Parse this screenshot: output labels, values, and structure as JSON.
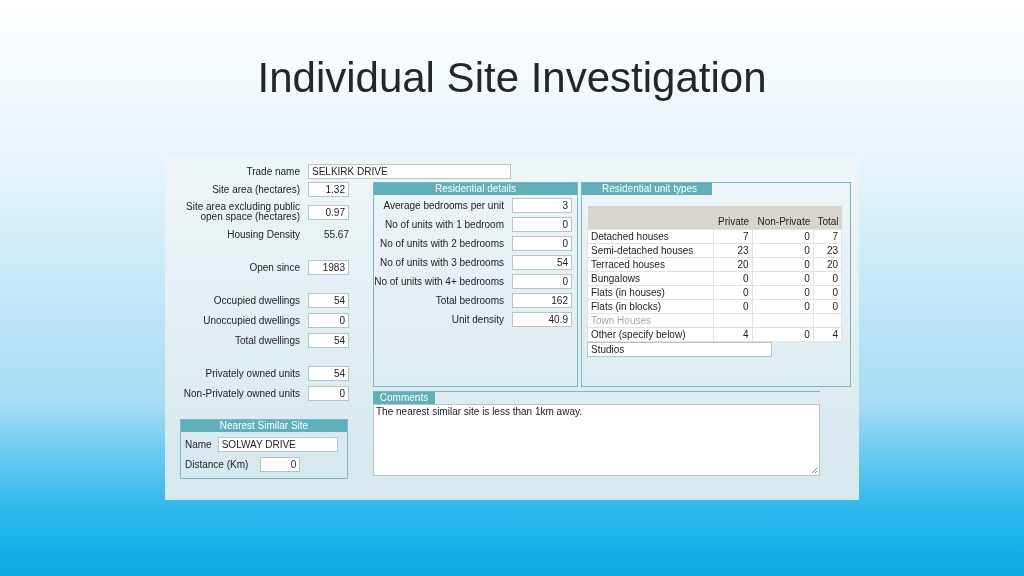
{
  "slide": {
    "title": "Individual Site Investigation"
  },
  "trade_name": {
    "label": "Trade name",
    "value": "SELKIRK DRIVE"
  },
  "site_groups": [
    {
      "fields": [
        {
          "label": "Site area (hectares)",
          "value": "1.32",
          "kind": "input"
        },
        {
          "label": "Site area excluding public open space (hectares)",
          "value": "0.97",
          "kind": "input"
        },
        {
          "label": "Housing Density",
          "value": "55.67",
          "kind": "readout"
        }
      ]
    },
    {
      "fields": [
        {
          "label": "Open since",
          "value": "1983",
          "kind": "input"
        }
      ]
    },
    {
      "fields": [
        {
          "label": "Occupied dwellings",
          "value": "54",
          "kind": "input"
        },
        {
          "label": "Unoccupied dwellings",
          "value": "0",
          "kind": "input"
        },
        {
          "label": "Total dwellings",
          "value": "54",
          "kind": "input"
        }
      ]
    },
    {
      "fields": [
        {
          "label": "Privately owned units",
          "value": "54",
          "kind": "input"
        },
        {
          "label": "Non-Privately owned units",
          "value": "0",
          "kind": "input"
        }
      ]
    }
  ],
  "nearest_site": {
    "header": "Nearest Similar Site",
    "name_label": "Name",
    "name": "SOLWAY DRIVE",
    "distance_label": "Distance (Km)",
    "distance": "0"
  },
  "residential_details": {
    "header": "Residential details",
    "fields": [
      {
        "label": "Average bedrooms per unit",
        "value": "3"
      },
      {
        "label": "No of units with 1 bedroom",
        "value": "0"
      },
      {
        "label": "No of units with 2 bedrooms",
        "value": "0"
      },
      {
        "label": "No of units with 3 bedrooms",
        "value": "54"
      },
      {
        "label": "No of units with 4+ bedrooms",
        "value": "0"
      },
      {
        "label": "Total bedrooms",
        "value": "162"
      },
      {
        "label": "Unit density",
        "value": "40.9"
      }
    ]
  },
  "unit_types": {
    "header": "Residential unit types",
    "columns": [
      "Private",
      "Non-Private",
      "Total"
    ],
    "rows": [
      {
        "label": "Detached houses",
        "private": "7",
        "non_private": "0",
        "total": "7",
        "disabled": false
      },
      {
        "label": "Semi-detached houses",
        "private": "23",
        "non_private": "0",
        "total": "23",
        "disabled": false
      },
      {
        "label": "Terraced houses",
        "private": "20",
        "non_private": "0",
        "total": "20",
        "disabled": false
      },
      {
        "label": "Bungalows",
        "private": "0",
        "non_private": "0",
        "total": "0",
        "disabled": false
      },
      {
        "label": "Flats (in houses)",
        "private": "0",
        "non_private": "0",
        "total": "0",
        "disabled": false
      },
      {
        "label": "Flats (in blocks)",
        "private": "0",
        "non_private": "0",
        "total": "0",
        "disabled": false
      },
      {
        "label": "Town Houses",
        "disabled": true
      },
      {
        "label": "Other (specify below)",
        "private": "4",
        "non_private": "0",
        "total": "4",
        "disabled": false
      }
    ],
    "other_value": "Studios"
  },
  "comments": {
    "header": "Comments",
    "text": "The nearest similar site is less than 1km away."
  }
}
